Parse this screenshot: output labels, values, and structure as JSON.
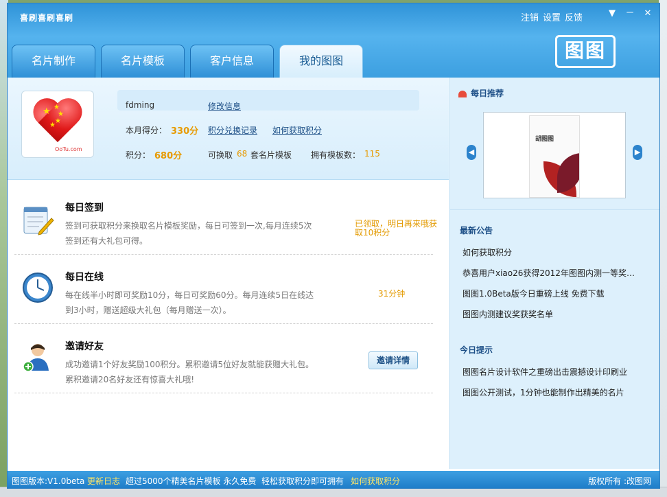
{
  "window": {
    "title": "喜刷喜刷喜刷",
    "top_links": [
      "注销",
      "设置",
      "反馈"
    ],
    "controls": [
      "▼",
      "－",
      "✕"
    ],
    "logo_text": "图图"
  },
  "tabs": [
    {
      "label": "名片制作",
      "active": false
    },
    {
      "label": "名片模板",
      "active": false
    },
    {
      "label": "客户信息",
      "active": false
    },
    {
      "label": "我的图图",
      "active": true
    }
  ],
  "profile": {
    "username": "fdming",
    "edit_link": "修改信息",
    "monthly_label": "本月得分：",
    "monthly_score": "330分",
    "exchange_record": "积分兑换记录",
    "how_to_get": "如何获取积分",
    "points_label": "积分：",
    "points": "680分",
    "exchange_prefix": "可换取",
    "exchange_count": "68",
    "exchange_suffix": "套名片模板",
    "templates_label": "拥有模板数：",
    "templates_count": "115",
    "avatar_mark": "OoTu.com"
  },
  "tasks": [
    {
      "title": "每日签到",
      "desc": "签到可获取积分来换取名片模板奖励，每日可签到一次,每月连续5次签到还有大礼包可得。",
      "status": "已领取，明日再来哦获取10积分",
      "icon": "notepad-pencil-icon"
    },
    {
      "title": "每日在线",
      "desc": "每在线半小时即可奖励10分，每日可奖励60分。每月连续5日在线达到3小时，赠送超级大礼包（每月赠送一次）。",
      "status": "31分钟",
      "icon": "clock-icon"
    },
    {
      "title": "邀请好友",
      "desc": "成功邀请1个好友奖励100积分。累积邀请5位好友就能获赠大礼包。累积邀请20名好友还有惊喜大礼哦!",
      "button": "邀请详情",
      "icon": "add-user-icon"
    }
  ],
  "sidebar": {
    "daily_title": "每日推荐",
    "card_name": "胡图图",
    "news_title": "最新公告",
    "news": [
      "如何获取积分",
      "恭喜用户xiao26获得2012年图图内测一等奖…",
      "图图1.0Beta版今日重磅上线 免费下载",
      "图图内测建议奖获奖名单"
    ],
    "tips_title": "今日提示",
    "tips": [
      "图图名片设计软件之重磅出击震撼设计印刷业",
      "图图公开测试，1分钟也能制作出精美的名片"
    ]
  },
  "statusbar": {
    "version": "图图版本:V1.0beta",
    "changelog": "更新日志",
    "promo1": "超过5000个精美名片模板 永久免费",
    "promo2": "轻松获取积分即可拥有",
    "how_link": "如何获取积分",
    "copyright": "版权所有 :改图网"
  },
  "colors": {
    "accent": "#2f93d8",
    "score": "#e79a00",
    "link": "#1c4e86"
  }
}
